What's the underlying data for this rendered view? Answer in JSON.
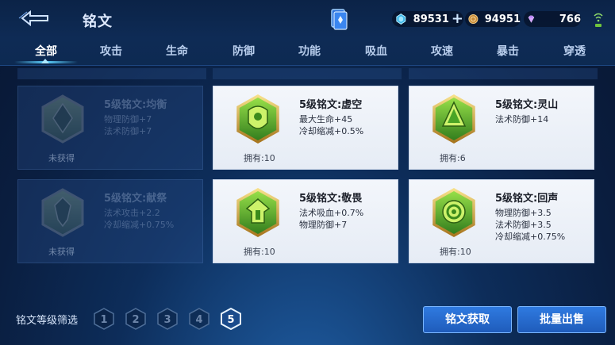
{
  "header": {
    "title": "铭文",
    "back_icon": "back-arrow-icon",
    "resources": [
      {
        "icon": "diamond-icon",
        "value": "89531",
        "has_plus": true
      },
      {
        "icon": "gold-coin-icon",
        "value": "94951"
      },
      {
        "icon": "gem-icon",
        "value": "766"
      }
    ]
  },
  "tabs": [
    "全部",
    "攻击",
    "生命",
    "防御",
    "功能",
    "吸血",
    "攻速",
    "暴击",
    "穿透"
  ],
  "active_tab": "全部",
  "cards": [
    {
      "name": "5级铭文:均衡",
      "stats": [
        "物理防御+7",
        "法术防御+7"
      ],
      "owned": "未获得",
      "obtained": false
    },
    {
      "name": "5级铭文:虚空",
      "stats": [
        "最大生命+45",
        "冷却缩减+0.5%"
      ],
      "owned": "拥有:10",
      "obtained": true
    },
    {
      "name": "5级铭文:灵山",
      "stats": [
        "法术防御+14"
      ],
      "owned": "拥有:6",
      "obtained": true
    },
    {
      "name": "5级铭文:献祭",
      "stats": [
        "法术攻击+2.2",
        "冷却缩减+0.75%"
      ],
      "owned": "未获得",
      "obtained": false
    },
    {
      "name": "5级铭文:敬畏",
      "stats": [
        "法术吸血+0.7%",
        "物理防御+7"
      ],
      "owned": "拥有:10",
      "obtained": true
    },
    {
      "name": "5级铭文:回声",
      "stats": [
        "物理防御+3.5",
        "法术防御+3.5",
        "冷却缩减+0.75%"
      ],
      "owned": "拥有:10",
      "obtained": true
    }
  ],
  "footer": {
    "filter_label": "铭文等级筛选",
    "levels": [
      "1",
      "2",
      "3",
      "4",
      "5"
    ],
    "selected_level": "5",
    "obtain_button": "铭文获取",
    "sell_button": "批量出售"
  },
  "colors": {
    "accent": "#5cd1ff",
    "button": "#2f7ae0",
    "emblem_green": "#6fc43c",
    "emblem_gold": "#d8b04a"
  }
}
